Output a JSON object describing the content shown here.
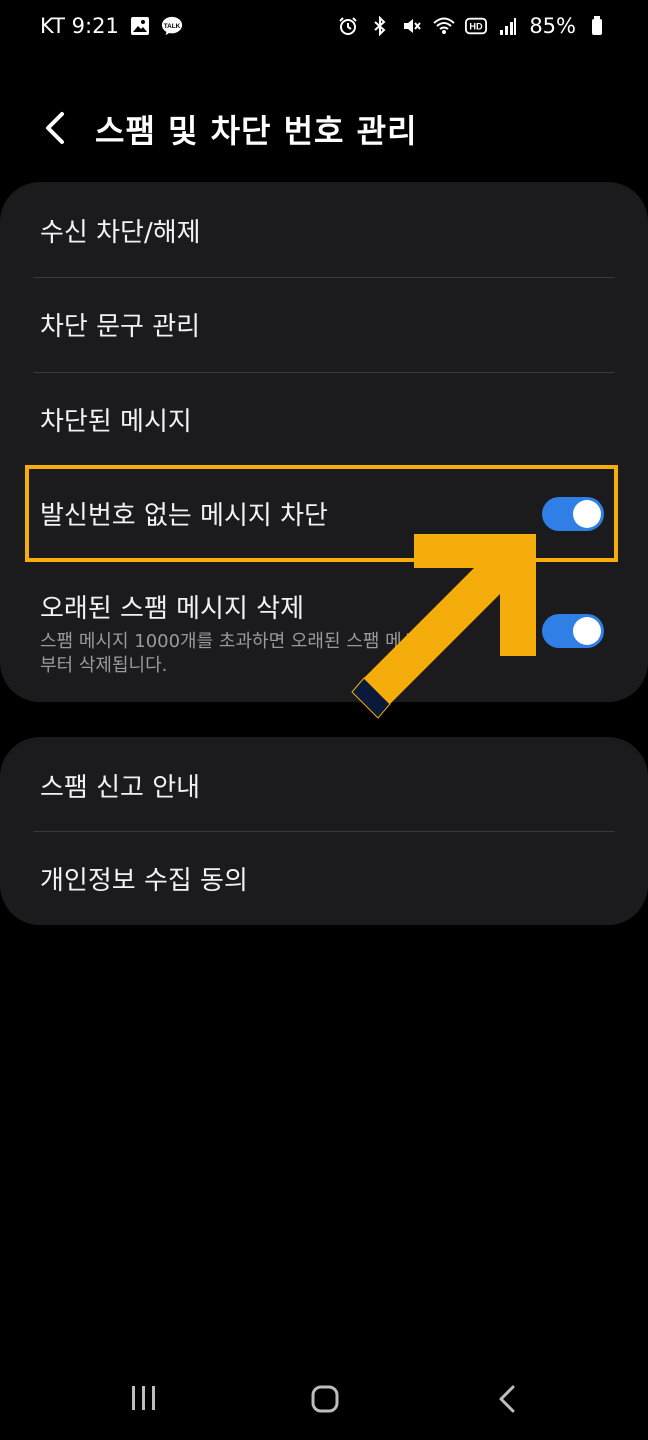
{
  "status": {
    "carrier_time": "KT 9:21",
    "battery": "85%",
    "icons_left": [
      "gallery-icon",
      "kakaotalk-icon"
    ],
    "icons_right": [
      "alarm-icon",
      "bluetooth-icon",
      "mute-icon",
      "wifi-icon",
      "hd-icon",
      "signal-icon",
      "battery-icon"
    ]
  },
  "header": {
    "title": "스팸 및 차단 번호 관리"
  },
  "section1": {
    "items": [
      {
        "label": "수신 차단/해제"
      },
      {
        "label": "차단 문구 관리"
      },
      {
        "label": "차단된 메시지"
      },
      {
        "label": "발신번호 없는 메시지 차단",
        "toggle": true
      },
      {
        "label": "오래된 스팸 메시지 삭제",
        "sublabel": "스팸 메시지 1000개를 초과하면 오래된 스팸 메시지부터 삭제됩니다.",
        "toggle": true
      }
    ]
  },
  "section2": {
    "items": [
      {
        "label": "스팸 신고 안내"
      },
      {
        "label": "개인정보 수집 동의"
      }
    ]
  },
  "colors": {
    "accent": "#2f7fe6",
    "highlight": "#f5ad0c",
    "card": "#1b1b1d"
  }
}
